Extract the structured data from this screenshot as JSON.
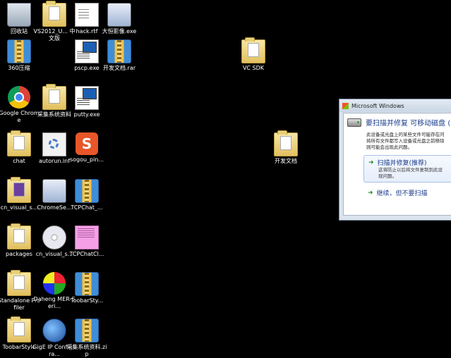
{
  "desktop": {
    "icons": [
      {
        "label": "回收站",
        "type": "bin"
      },
      {
        "label": "VS2012_U... 中文版",
        "type": "folder"
      },
      {
        "label": "hack.rtf",
        "type": "docfile"
      },
      {
        "label": "大恒影像.exe",
        "type": "installer"
      },
      {
        "label": "360压缩",
        "type": "archive"
      },
      {
        "label": "pscp.exe",
        "type": "exe"
      },
      {
        "label": "开发文档.rar",
        "type": "archive"
      },
      {
        "label": "VC SDK",
        "type": "folder"
      },
      {
        "label": "Google Chrome",
        "type": "chrome"
      },
      {
        "label": "采集系统资料",
        "type": "folder"
      },
      {
        "label": "putty.exe",
        "type": "exe"
      },
      {
        "label": "chat",
        "type": "folder"
      },
      {
        "label": "autorun.inf",
        "type": "gear"
      },
      {
        "label": "sogou_pin...",
        "type": "sogou"
      },
      {
        "label": "开发文档",
        "type": "folder"
      },
      {
        "label": "cn_visual_s...",
        "type": "folder-purple"
      },
      {
        "label": "ChromeSe...",
        "type": "installer"
      },
      {
        "label": "TCPChat_...",
        "type": "archive"
      },
      {
        "label": "packages",
        "type": "folder"
      },
      {
        "label": "cn_visual_s...",
        "type": "disc"
      },
      {
        "label": "TCPChatCl...",
        "type": "pink"
      },
      {
        "label": "Standalone Profiler",
        "type": "folder"
      },
      {
        "label": "Daheng MER-Seri...",
        "type": "daheng"
      },
      {
        "label": "ToobarSty...",
        "type": "archive"
      },
      {
        "label": "ToobarStyle",
        "type": "folder"
      },
      {
        "label": "GigE IP Configura...",
        "type": "gige"
      },
      {
        "label": "采集系统资料.zip",
        "type": "archive"
      }
    ]
  },
  "dialog": {
    "title": "Microsoft Windows",
    "heading": "要扫描并修复 可移动磁盘 (I",
    "desc_line1": "此设备或光盘上的某些文件可能存在问",
    "desc_line2": "将所有文件都写入设备或光盘之前移除",
    "desc_line3": "则可能会出现此问题。",
    "option1_label": "扫描并修复(推荐)",
    "option1_desc1": "这将防止以后将文件复制到此设",
    "option1_desc2": "现问题。",
    "option2_label": "继续，但不要扫描",
    "arrow": "➜"
  },
  "colors": {
    "desktop_bg": "#000000",
    "link_blue": "#1a3c8c",
    "arrow_green": "#1e8a2d"
  }
}
